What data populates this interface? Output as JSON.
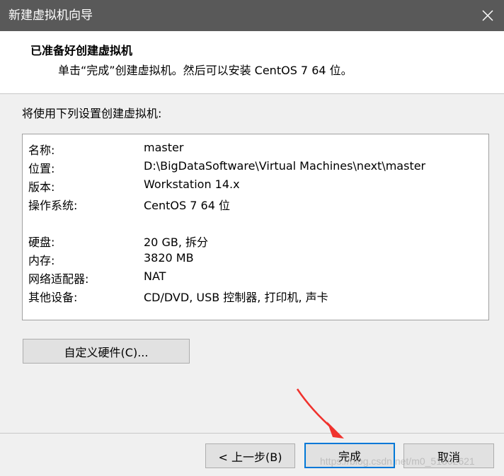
{
  "window": {
    "title": "新建虚拟机向导",
    "close_icon": "close-icon"
  },
  "header": {
    "title": "已准备好创建虚拟机",
    "subtitle": "单击“完成”创建虚拟机。然后可以安装 CentOS 7 64 位。"
  },
  "intro": "将使用下列设置创建虚拟机:",
  "summary": {
    "rows": [
      {
        "key": "名称:",
        "value": "master"
      },
      {
        "key": "位置:",
        "value": "D:\\BigDataSoftware\\Virtual Machines\\next\\master"
      },
      {
        "key": "版本:",
        "value": "Workstation 14.x"
      },
      {
        "key": "操作系统:",
        "value": "CentOS 7 64 位"
      },
      {
        "key": "硬盘:",
        "value": "20 GB, 拆分"
      },
      {
        "key": "内存:",
        "value": "3820 MB"
      },
      {
        "key": "网络适配器:",
        "value": "NAT"
      },
      {
        "key": "其他设备:",
        "value": "CD/DVD, USB 控制器, 打印机, 声卡"
      }
    ]
  },
  "buttons": {
    "customize": "自定义硬件(C)...",
    "back": "< 上一步(B)",
    "finish": "完成",
    "cancel": "取消"
  },
  "annotation": {
    "arrow_color": "#f0322d"
  },
  "watermark": "https://blog.csdn.net/m0_51302621"
}
